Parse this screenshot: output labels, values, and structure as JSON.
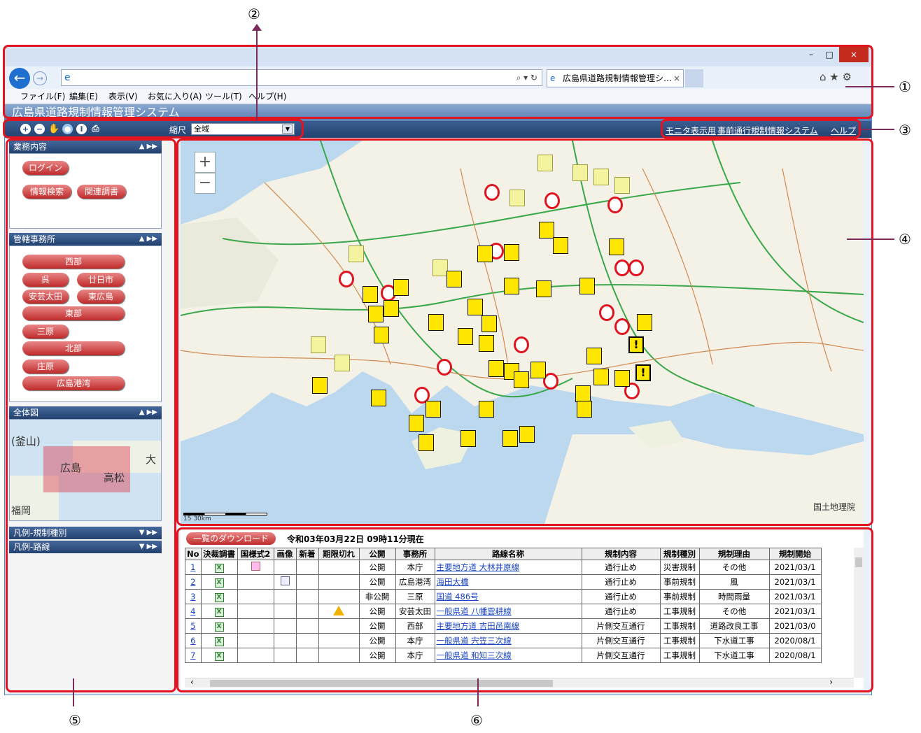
{
  "callouts": {
    "c1": "①",
    "c2": "②",
    "c3": "③",
    "c4": "④",
    "c5": "⑤",
    "c6": "⑥"
  },
  "window": {
    "minimize": "–",
    "maximize": "□",
    "close": "×"
  },
  "browser": {
    "address_value": "",
    "address_icons": "⌕ ▾ ↻",
    "tab_title": "広島県道路規制情報管理シ…",
    "tab_close": "×",
    "right_icons": "⌂ ★ ⚙",
    "menu": [
      "ファイル(F)",
      "編集(E)",
      "表示(V)",
      "お気に入り(A)",
      "ツール(T)",
      "ヘルプ(H)"
    ]
  },
  "app": {
    "title": "広島県道路規制情報管理システム",
    "scale_label": "縮尺",
    "scale_value": "全域",
    "links": [
      "モニタ表示用",
      "事前通行規制情報システム",
      "ヘルプ"
    ]
  },
  "panels": {
    "business": {
      "title": "業務内容",
      "buttons": [
        "ログイン",
        "情報検索",
        "関連調書"
      ]
    },
    "offices": {
      "title": "管轄事務所",
      "buttons": [
        "西部",
        "呉",
        "廿日市",
        "安芸太田",
        "東広島",
        "東部",
        "三原",
        "北部",
        "庄原",
        "広島港湾"
      ]
    },
    "overview": {
      "title": "全体図",
      "labels": [
        "(釜山)",
        "広島",
        "高松",
        "大",
        "福岡"
      ]
    },
    "legend_type": {
      "title": "凡例-規制種別"
    },
    "legend_road": {
      "title": "凡例-路線"
    }
  },
  "map": {
    "attribution": "国土地理院",
    "scale_text": "15     30km",
    "zoom_in": "+",
    "zoom_out": "−"
  },
  "list": {
    "download_label": "一覧のダウンロード",
    "as_of": "令和03年03月22日 09時11分現在",
    "headers": [
      "No",
      "決裁調書",
      "国様式2",
      "画像",
      "新着",
      "期限切れ",
      "公開",
      "事務所",
      "路線名称",
      "規制内容",
      "規制種別",
      "規制理由",
      "規制開始"
    ],
    "rows": [
      [
        "1",
        "公開",
        "本庁",
        "主要地方道 大林井原線",
        "通行止め",
        "災害規制",
        "その他",
        "2021/03/1"
      ],
      [
        "2",
        "公開",
        "広島港湾",
        "海田大橋",
        "通行止め",
        "事前規制",
        "風",
        "2021/03/1"
      ],
      [
        "3",
        "非公開",
        "三原",
        "国道 486号",
        "通行止め",
        "事前規制",
        "時間雨量",
        "2021/03/1"
      ],
      [
        "4",
        "公開",
        "安芸太田",
        "一般県道 八幡雲耕線",
        "通行止め",
        "工事規制",
        "その他",
        "2021/03/1"
      ],
      [
        "5",
        "公開",
        "西部",
        "主要地方道 吉田邑南線",
        "片側交互通行",
        "工事規制",
        "道路改良工事",
        "2021/03/0"
      ],
      [
        "6",
        "公開",
        "本庁",
        "一般県道 宍笠三次線",
        "片側交互通行",
        "工事規制",
        "下水道工事",
        "2020/08/1"
      ],
      [
        "7",
        "公開",
        "本庁",
        "一般県道 和知三次線",
        "片側交互通行",
        "工事規制",
        "下水道工事",
        "2020/08/1"
      ]
    ]
  }
}
